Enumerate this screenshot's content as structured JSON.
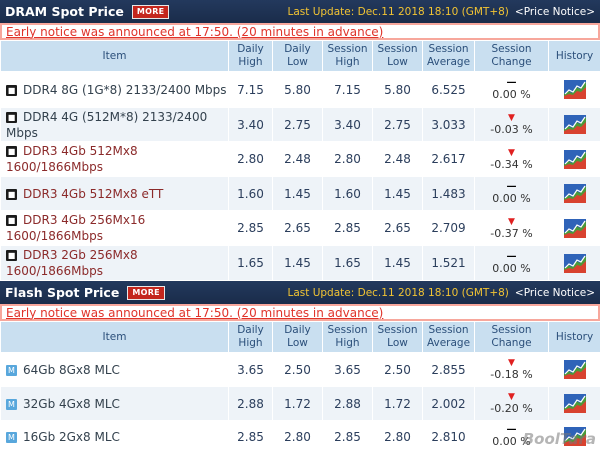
{
  "dram": {
    "title": "DRAM Spot Price",
    "more": "MORE",
    "last_update": "Last Update: Dec.11 2018 18:10 (GMT+8)",
    "price_notice": "<Price Notice>",
    "early_notice": "Early notice was announced at 17:50. (20 minutes in advance)",
    "headers": [
      "Item",
      "Daily\nHigh",
      "Daily\nLow",
      "Session\nHigh",
      "Session\nLow",
      "Session\nAverage",
      "Session\nChange",
      "History"
    ],
    "rows": [
      {
        "item": "DDR4 8G (1G*8) 2133/2400 Mbps",
        "dh": "7.15",
        "dl": "5.80",
        "sh": "7.15",
        "sl": "5.80",
        "avg": "6.525",
        "ind": "dash",
        "chg": "0.00 %"
      },
      {
        "item": "DDR4 4G (512M*8) 2133/2400 Mbps",
        "dh": "3.40",
        "dl": "2.75",
        "sh": "3.40",
        "sl": "2.75",
        "avg": "3.033",
        "ind": "down",
        "chg": "-0.03 %"
      },
      {
        "item": "DDR3 4Gb 512Mx8 1600/1866Mbps",
        "dh": "2.80",
        "dl": "2.48",
        "sh": "2.80",
        "sl": "2.48",
        "avg": "2.617",
        "ind": "down",
        "chg": "-0.34 %"
      },
      {
        "item": "DDR3 4Gb 512Mx8 eTT",
        "dh": "1.60",
        "dl": "1.45",
        "sh": "1.60",
        "sl": "1.45",
        "avg": "1.483",
        "ind": "dash",
        "chg": "0.00 %"
      },
      {
        "item": "DDR3 4Gb 256Mx16 1600/1866Mbps",
        "dh": "2.85",
        "dl": "2.65",
        "sh": "2.85",
        "sl": "2.65",
        "avg": "2.709",
        "ind": "down",
        "chg": "-0.37 %"
      },
      {
        "item": "DDR3 2Gb 256Mx8 1600/1866Mbps",
        "dh": "1.65",
        "dl": "1.45",
        "sh": "1.65",
        "sl": "1.45",
        "avg": "1.521",
        "ind": "dash",
        "chg": "0.00 %"
      }
    ]
  },
  "flash": {
    "title": "Flash Spot Price",
    "more": "MORE",
    "last_update": "Last Update: Dec.11 2018 18:10 (GMT+8)",
    "price_notice": "<Price Notice>",
    "early_notice": "Early notice was announced at 17:50. (20 minutes in advance)",
    "headers": [
      "Item",
      "Daily\nHigh",
      "Daily\nLow",
      "Session\nHigh",
      "Session\nLow",
      "Session\nAverage",
      "Session\nChange",
      "History"
    ],
    "rows": [
      {
        "item": "64Gb 8Gx8 MLC",
        "dh": "3.65",
        "dl": "2.50",
        "sh": "3.65",
        "sl": "2.50",
        "avg": "2.855",
        "ind": "down",
        "chg": "-0.18 %"
      },
      {
        "item": "32Gb 4Gx8 MLC",
        "dh": "2.88",
        "dl": "1.72",
        "sh": "2.88",
        "sl": "1.72",
        "avg": "2.002",
        "ind": "down",
        "chg": "-0.20 %"
      },
      {
        "item": "16Gb 2Gx8 MLC",
        "dh": "2.85",
        "dl": "2.80",
        "sh": "2.85",
        "sl": "2.80",
        "avg": "2.810",
        "ind": "dash",
        "chg": "0.00 %"
      }
    ]
  },
  "watermark": "BoolTara",
  "colors": {
    "header_bg": "#1a2c4a",
    "more_bg": "#c4261d",
    "update_text": "#f2c433",
    "notice_text": "#e0332a",
    "th_bg": "#c9dff0",
    "down": "#e02020"
  },
  "icons": {
    "dram_badge": "chip-icon-dark",
    "flash_badge": "chip-icon-blue",
    "history": "line-chart-icon",
    "change_down": "down-arrow-icon",
    "change_flat": "dash-icon"
  }
}
